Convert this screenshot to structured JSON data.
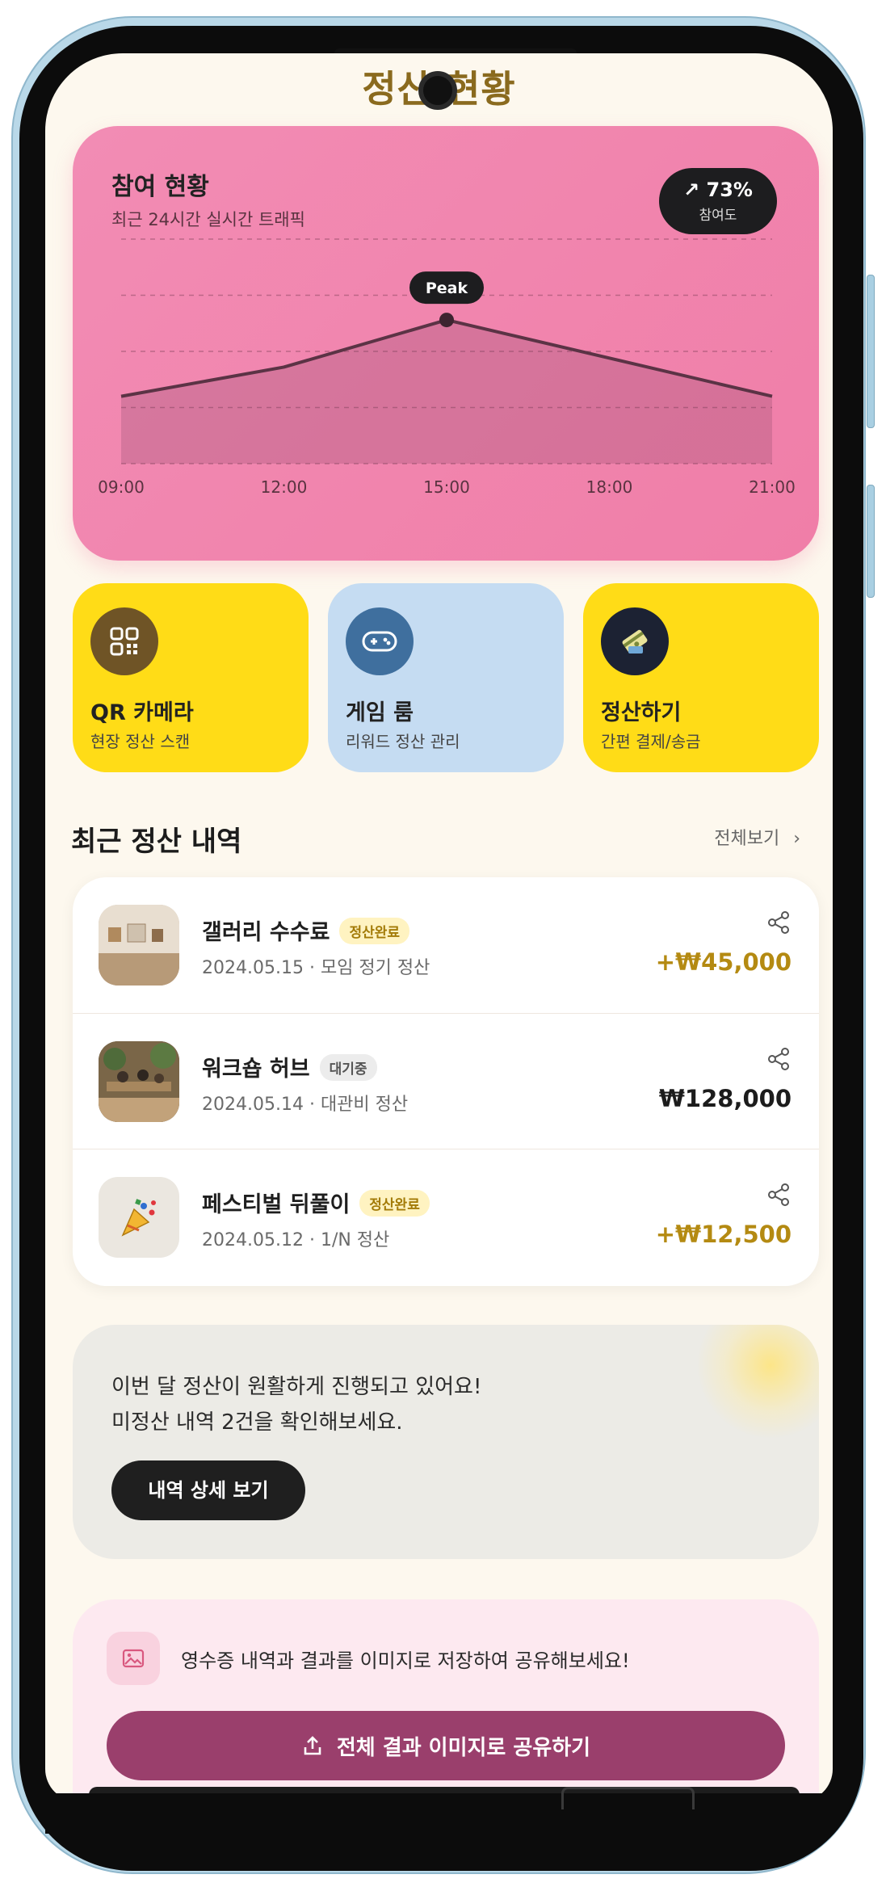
{
  "header": {
    "title": "정산 현황"
  },
  "participation": {
    "title": "참여 현황",
    "subtitle": "최근 24시간 실시간 트래픽",
    "badge_value": "73%",
    "badge_label": "참여도",
    "peak_label": "Peak"
  },
  "chart_data": {
    "type": "area",
    "x": [
      "09:00",
      "12:00",
      "15:00",
      "18:00",
      "21:00"
    ],
    "series": [
      {
        "values": [
          30,
          43,
          64,
          47,
          30
        ]
      }
    ],
    "ylim": [
      0,
      100
    ],
    "grid": true,
    "annotations": [
      {
        "x": "15:00",
        "text": "Peak"
      }
    ]
  },
  "quick_actions": [
    {
      "title": "QR 카메라",
      "subtitle": "현장 정산 스캔",
      "icon": "qr-code-icon",
      "color": "#ffdc17"
    },
    {
      "title": "게임 룸",
      "subtitle": "리워드 정산 관리",
      "icon": "gamepad-icon",
      "color": "#c5dcf2"
    },
    {
      "title": "정산하기",
      "subtitle": "간편 결제/송금",
      "icon": "payment-icon",
      "color": "#ffdc17"
    }
  ],
  "recent": {
    "title": "최근 정산 내역",
    "see_all": "전체보기",
    "items": [
      {
        "title": "갤러리 수수료",
        "tag": "정산완료",
        "date": "2024.05.15 · 모임 정기 정산",
        "amount": "+₩45,000",
        "thumb": "gallery-photo"
      },
      {
        "title": "워크숍 허브",
        "tag": "대기중",
        "date": "2024.05.14 · 대관비 정산",
        "amount": "₩128,000",
        "thumb": "workshop-photo"
      },
      {
        "title": "페스티벌 뒤풀이",
        "tag": "정산완료",
        "date": "2024.05.12 · 1/N 정산",
        "amount": "+₩12,500",
        "thumb": "party-popper-icon"
      }
    ]
  },
  "notice": {
    "line1": "이번 달 정산이 원활하게 진행되고 있어요!",
    "line2": "미정산 내역 2건을 확인해보세요.",
    "button": "내역 상세 보기"
  },
  "share": {
    "text": "영수증 내역과 결과를 이미지로 저장하여 공유해보세요!",
    "button": "전체 결과 이미지로 공유하기"
  },
  "colors": {
    "accent_pink": "#f07ea8",
    "accent_yellow": "#ffdc17",
    "share_purple": "#9a3f6c",
    "amount_gold": "#b48a12"
  }
}
